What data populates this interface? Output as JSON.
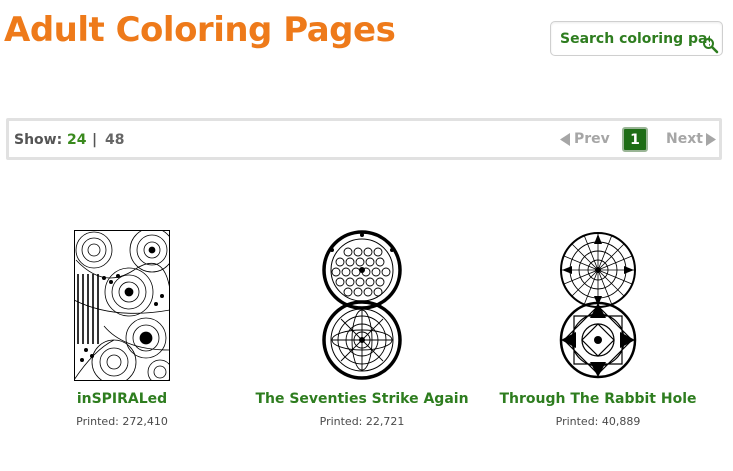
{
  "page": {
    "title": "Adult Coloring Pages"
  },
  "search": {
    "placeholder": "Search coloring pages",
    "icon": "search-icon"
  },
  "pagination": {
    "show_label": "Show:",
    "show_options": [
      "24",
      "48"
    ],
    "separator": "|",
    "selected_show": "24",
    "prev_label": "Prev",
    "current_page": "1",
    "next_label": "Next"
  },
  "cards": [
    {
      "title": "inSPIRALed",
      "printed": "Printed: 272,410"
    },
    {
      "title": "The Seventies Strike Again",
      "printed": "Printed: 22,721"
    },
    {
      "title": "Through The Rabbit Hole",
      "printed": "Printed: 40,889"
    }
  ],
  "colors": {
    "title_orange": "#ee7a1a",
    "link_green": "#2e7d1f",
    "page_active_green": "#1e6d16",
    "disabled_gray": "#a6a6a6"
  }
}
